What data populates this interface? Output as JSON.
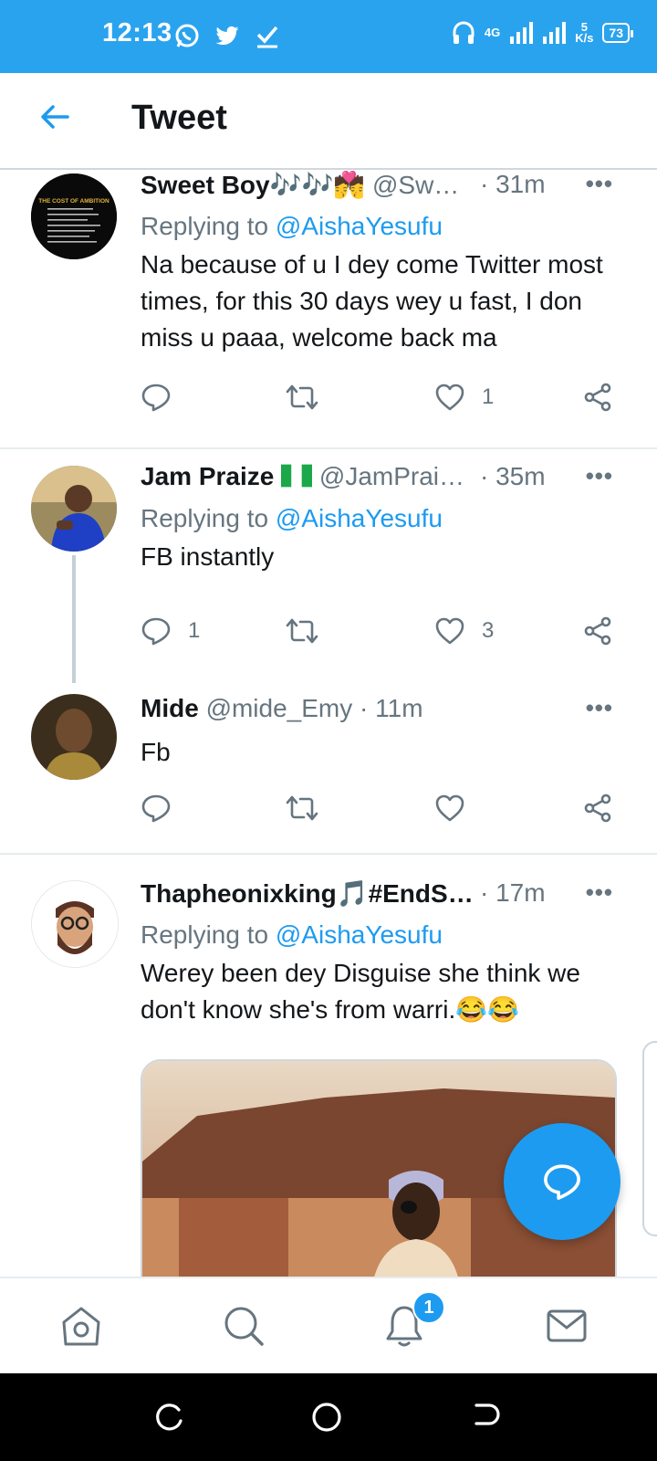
{
  "status_bar": {
    "time": "12:13",
    "network": "4G",
    "speed_value": "5",
    "speed_unit": "K/s",
    "battery": "73"
  },
  "header": {
    "title": "Tweet"
  },
  "tweets": [
    {
      "name": "Sweet Boy",
      "name_emoji": "🎶🎶💏",
      "handle": "@Sw…",
      "time": "· 31m",
      "replying_prefix": "Replying to ",
      "replying_to": "@AishaYesufu",
      "text": "Na because of u I dey come Twitter most times, for this 30 days wey u fast, I don miss u paaa, welcome back ma",
      "replies": "",
      "retweets": "",
      "likes": "1"
    },
    {
      "name": "Jam Praize",
      "name_emoji": "🇳🇬",
      "handle": "@JamPrai…",
      "time": "· 35m",
      "replying_prefix": "Replying to ",
      "replying_to": "@AishaYesufu",
      "text": "FB instantly",
      "replies": "1",
      "retweets": "",
      "likes": "3"
    },
    {
      "name": "Mide",
      "handle": "@mide_Emy",
      "time": "· 11m",
      "text": "Fb",
      "replies": "",
      "retweets": "",
      "likes": ""
    },
    {
      "name": "Thapheonixking",
      "name_emoji": "🎵",
      "name_suffix": "#EndS…",
      "time": "· 17m",
      "replying_prefix": "Replying to ",
      "replying_to": "@AishaYesufu",
      "text": "Werey been dey Disguise she think we don't know she's from warri.😂😂"
    }
  ],
  "avatar_captions": {
    "sweet_boy": "THE COST OF AMBITION"
  },
  "more_glyph": "•••",
  "notifications_badge": "1",
  "colors": {
    "status_bar": "#2aa3ef",
    "accent": "#1d9bf0",
    "muted": "#66757f"
  },
  "icons": [
    "whatsapp-icon",
    "twitter-icon",
    "check-icon",
    "headset-icon",
    "signal-icon",
    "battery-icon",
    "back-arrow-icon",
    "more-icon",
    "reply-icon",
    "retweet-icon",
    "like-icon",
    "share-icon",
    "compose-reply-icon",
    "home-icon",
    "search-icon",
    "notifications-icon",
    "messages-icon"
  ]
}
